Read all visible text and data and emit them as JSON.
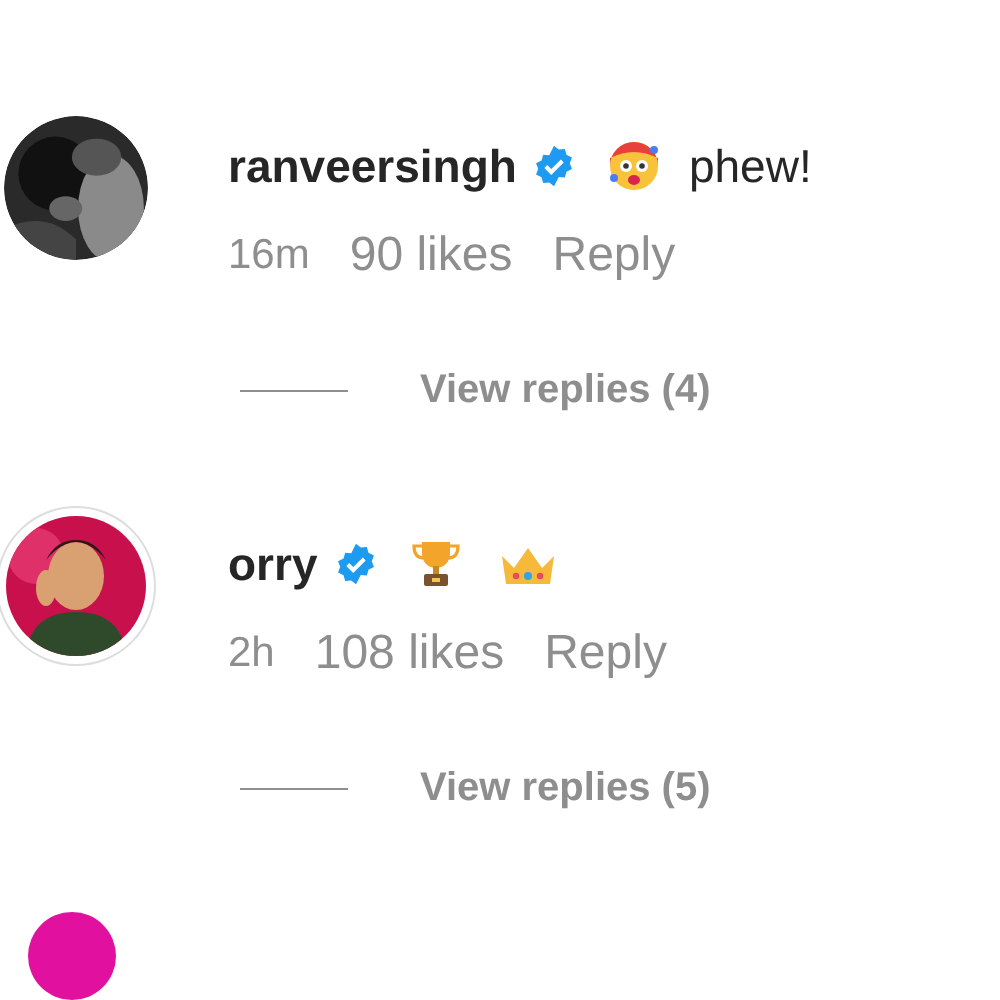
{
  "comments": [
    {
      "avatar": {
        "kind": "picture",
        "ring": false
      },
      "username": "ranveersingh",
      "verified": true,
      "emojis": [
        {
          "kind": "hot-face"
        }
      ],
      "text": "phew!",
      "time": "16m",
      "likes": "90 likes",
      "reply": "Reply",
      "replies": "View replies (4)"
    },
    {
      "avatar": {
        "kind": "picture",
        "ring": true
      },
      "username": "orry",
      "verified": true,
      "emojis": [
        {
          "kind": "trophy"
        },
        {
          "kind": "crown"
        }
      ],
      "time": "2h",
      "likes": "108 likes",
      "reply": "Reply",
      "replies": "View replies (5)"
    }
  ],
  "next_avatar": {
    "kind": "picture"
  }
}
